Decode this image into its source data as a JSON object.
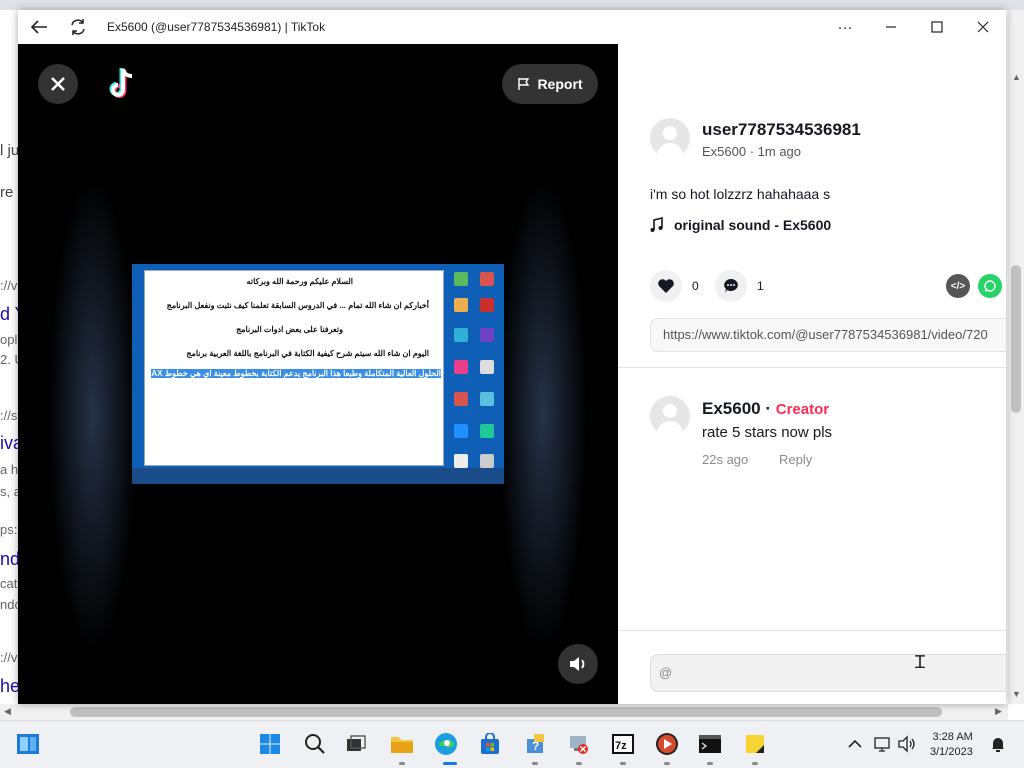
{
  "window": {
    "title": "Ex5600 (@user7787534536981) | TikTok",
    "report_label": "Report"
  },
  "video": {
    "doc_lines": [
      "السلام عليكم ورحمة الله وبركاته",
      "أخباركم ان شاء الله تمام ... في الدروس السابقة تعلمنا كيف نثبت ونفعل البرنامج",
      "وتعرفنا على بعض ادوات البرنامج",
      "اليوم ان شاء الله سيتم شرح كيفية الكتابة في البرنامج باللغة العربية برنامج",
      "الحلول العالية المتكاملة وطبعا هذا البرنامج يدعم الكتابة بخطوط معينة اي هي خطوط AX"
    ]
  },
  "post": {
    "username": "user7787534536981",
    "meta": "Ex5600 · 1m ago",
    "caption": "i'm so hot lolzzrz hahahaaa s",
    "sound": "original sound - Ex5600",
    "likes": "0",
    "comments": "1",
    "link": "https://www.tiktok.com/@user7787534536981/video/720"
  },
  "comment": {
    "author": "Ex5600",
    "separator": " · ",
    "badge": "Creator",
    "text": "rate 5 stars now pls",
    "time": "22s ago",
    "reply_label": "Reply"
  },
  "comment_input": {
    "value": "@"
  },
  "background": {
    "snippets": [
      "l ju",
      "re c",
      "://v",
      "d Y",
      "ople",
      "2. U",
      "://s",
      "iva",
      "a ho",
      "s, a",
      "ps:",
      "nd",
      "cat",
      "ndo",
      "://v",
      "her"
    ]
  },
  "taskbar": {
    "time": "3:28 AM",
    "date": "3/1/2023"
  },
  "colors": {
    "accent": "#fe2c55",
    "whatsapp": "#25d366",
    "video_bg": "#000000"
  }
}
